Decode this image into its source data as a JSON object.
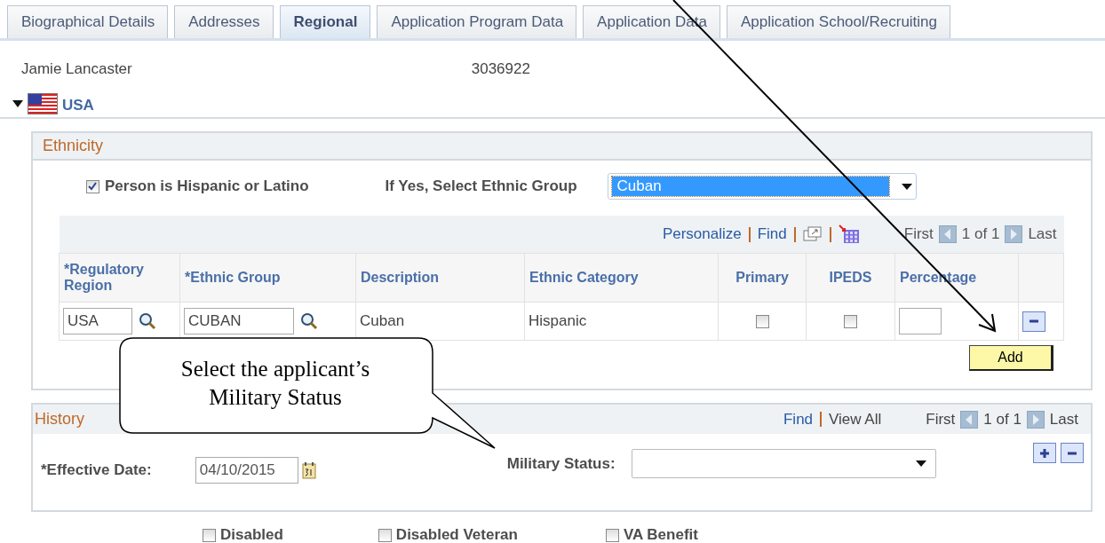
{
  "tabs": [
    {
      "label": "Biographical Details",
      "selected": false
    },
    {
      "label": "Addresses",
      "selected": false
    },
    {
      "label": "Regional",
      "selected": true
    },
    {
      "label": "Application Program Data",
      "selected": false
    },
    {
      "label": "Application Data",
      "selected": false
    },
    {
      "label": "Application School/Recruiting",
      "selected": false
    }
  ],
  "person": {
    "name": "Jamie Lancaster",
    "id": "3036922"
  },
  "region": {
    "label": "USA",
    "expanded": true
  },
  "ethnicity": {
    "title": "Ethnicity",
    "hispanic": {
      "label": "Person is Hispanic or Latino",
      "checked": true
    },
    "group_select": {
      "label": "If Yes, Select Ethnic Group",
      "value": "Cuban",
      "focused": true
    },
    "toolbar": {
      "personalize": "Personalize",
      "find": "Find",
      "first": "First",
      "count": "1 of 1",
      "last": "Last"
    },
    "columns": [
      "*Regulatory Region",
      "*Ethnic Group",
      "Description",
      "Ethnic Category",
      "Primary",
      "IPEDS",
      "Percentage"
    ],
    "rows": [
      {
        "region": "USA",
        "group": "CUBAN",
        "description": "Cuban",
        "category": "Hispanic",
        "primary": false,
        "ipeds": false
      }
    ],
    "add_button": "Add"
  },
  "history": {
    "title": "History",
    "find": "Find",
    "view_all": "View All",
    "first": "First",
    "count": "1 of 1",
    "last": "Last",
    "effective_date": {
      "label": "*Effective Date:",
      "value": "04/10/2015"
    },
    "military_status": {
      "label": "Military Status:"
    }
  },
  "flags": [
    {
      "label": "Disabled",
      "checked": false
    },
    {
      "label": "Disabled Veteran",
      "checked": false
    },
    {
      "label": "VA Benefit",
      "checked": false
    }
  ],
  "callout": {
    "text": "Select the applicant’s Military Status"
  }
}
